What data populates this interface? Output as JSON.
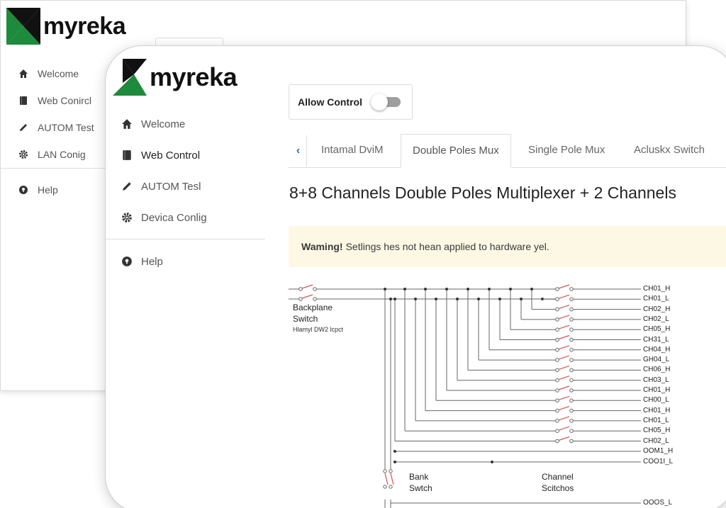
{
  "brand": {
    "name": "myreka",
    "colors": {
      "green": "#1e8a3c",
      "black": "#111111"
    }
  },
  "back_window": {
    "nav": [
      {
        "label": "Welcome",
        "icon": "home-icon"
      },
      {
        "label": "Web Conircl",
        "icon": "book-icon"
      },
      {
        "label": "AUTOM Test",
        "icon": "pencil-icon"
      },
      {
        "label": "LAN Conig",
        "icon": "gear-icon"
      }
    ],
    "help": {
      "label": "Help",
      "icon": "help-icon"
    }
  },
  "front_window": {
    "nav": [
      {
        "label": "Welcome",
        "icon": "home-icon"
      },
      {
        "label": "Web Control",
        "icon": "book-icon",
        "active": true
      },
      {
        "label": "AUTOM Tesl",
        "icon": "pencil-icon"
      },
      {
        "label": "Devica Conlig",
        "icon": "gear-icon"
      }
    ],
    "help": {
      "label": "Help",
      "icon": "help-icon"
    },
    "allow_control": {
      "label": "Allow Control",
      "enabled": false
    },
    "tabs": [
      {
        "label": "Intamal DviM"
      },
      {
        "label": "Double Poles Mux",
        "active": true
      },
      {
        "label": "Single Pole Mux"
      },
      {
        "label": "Acluskx Switch"
      }
    ],
    "title": "8+8 Channels Double Poles Multiplexer + 2 Channels",
    "warning": {
      "strong": "Waming!",
      "text": "Setlings hes not hean applied to hardware yel."
    },
    "diagram": {
      "backplane_label": "Backplane",
      "backplane_label2": "Switch",
      "backplane_sub": "Hlamyl DW2 lcpct",
      "bank_label": "Bank",
      "bank_label2": "Swtch",
      "channel_label": "Channel",
      "channel_label2": "Scitchos",
      "channels": [
        "CH01_H",
        "CH01_L",
        "CH02_H",
        "CH02_L",
        "CH05_H",
        "CH31_L",
        "CH04_H",
        "GH04_L",
        "CH06_H",
        "CH03_L",
        "CH01_H",
        "CH00_L",
        "CH01_H",
        "CH01_L",
        "CH05_H",
        "CH02_L"
      ],
      "com_lines": [
        "OOM1_H",
        "COO1I_L"
      ],
      "bottom_label": "OOOS_L"
    }
  }
}
